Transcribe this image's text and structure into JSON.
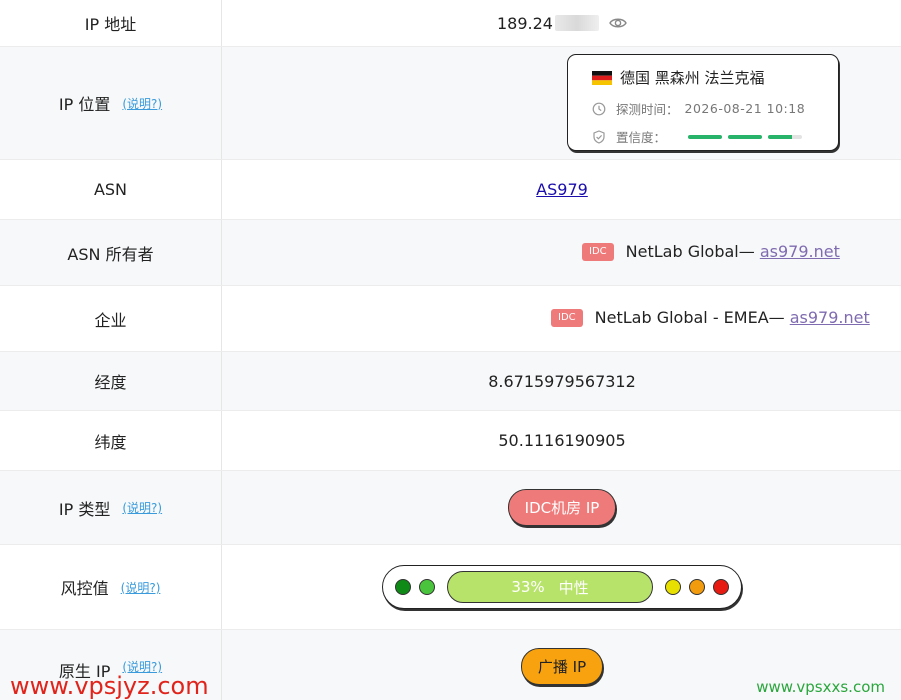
{
  "rows": {
    "ip": {
      "label": "IP 地址",
      "value_visible": "189.24"
    },
    "location": {
      "label": "IP 位置",
      "help": "(说明?)",
      "place": "德国 黑森州 法兰克福",
      "probe_label": "探测时间：",
      "probe_time": "2026-08-21 10:18",
      "confidence_label": "置信度："
    },
    "asn": {
      "label": "ASN",
      "value": "AS979"
    },
    "asn_owner": {
      "label": "ASN 所有者",
      "tag": "IDC",
      "name": "NetLab Global— ",
      "domain": "as979.net"
    },
    "company": {
      "label": "企业",
      "tag": "IDC",
      "name": "NetLab Global - EMEA— ",
      "domain": "as979.net"
    },
    "longitude": {
      "label": "经度",
      "value": "8.6715979567312"
    },
    "latitude": {
      "label": "纬度",
      "value": "50.1116190905"
    },
    "ip_type": {
      "label": "IP 类型",
      "help": "(说明?)",
      "value": "IDC机房 IP"
    },
    "risk": {
      "label": "风控值",
      "help": "(说明?)",
      "percent": "33%",
      "level": "中性"
    },
    "native": {
      "label": "原生 IP",
      "help": "(说明?)",
      "value": "广播 IP"
    }
  },
  "watermarks": {
    "left": "www.vpsjyz.com",
    "right": "www.vpsxxs.com"
  },
  "colors": {
    "help_link": "#3a9bdc",
    "idc_tag": "#ef7a7a",
    "confidence": "#27b36a",
    "risk_bar": "#b7e36b",
    "native_pill": "#f7a20e",
    "risk_dots": [
      "#0f8a16",
      "#4ac43d",
      "#e8e000",
      "#f29b0c",
      "#e81b12"
    ]
  },
  "icons": [
    "germany-flag",
    "eye-icon",
    "clock-icon",
    "shield-check-icon"
  ]
}
